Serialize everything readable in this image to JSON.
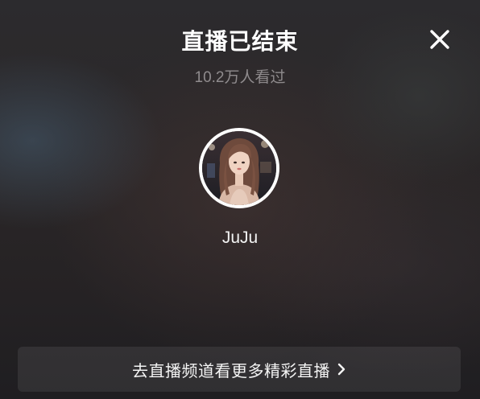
{
  "live_end": {
    "title": "直播已结束",
    "viewers": "10.2万人看过",
    "close_icon": "close-icon"
  },
  "streamer": {
    "name": "JuJu",
    "avatar_icon": "avatar-photo"
  },
  "footer": {
    "channel_button_label": "去直播频道看更多精彩直播",
    "chevron_icon": "chevron-right-icon"
  },
  "colors": {
    "title": "#ffffff",
    "viewers_text": "#8f8b8d",
    "avatar_ring": "#ffffff",
    "button_bg": "rgba(255,255,255,0.08)"
  }
}
